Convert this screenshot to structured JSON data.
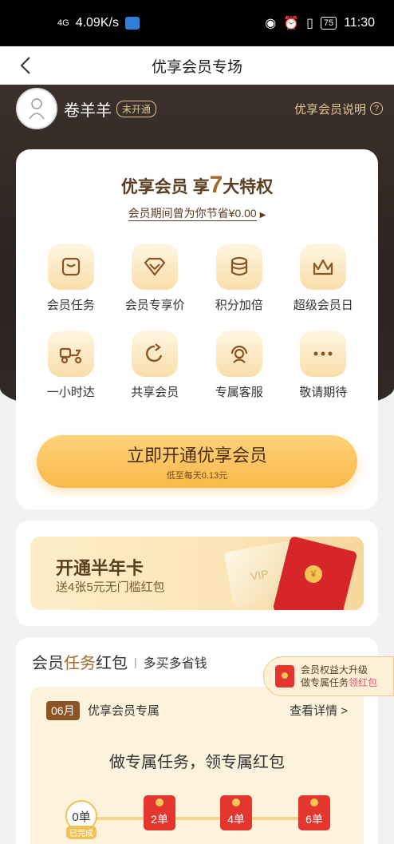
{
  "status_bar": {
    "signal": "4G",
    "speed": "4.09K/s",
    "battery": "75",
    "time": "11:30"
  },
  "nav": {
    "title": "优享会员专场"
  },
  "user": {
    "name": "卷羊羊",
    "membership_status": "未开通",
    "explain_link": "优享会员说明"
  },
  "privileges": {
    "title_prefix": "优享会员 享",
    "title_count": "7",
    "title_suffix": "大特权",
    "saving_text": "会员期间曾为你节省¥0.00",
    "items": [
      {
        "label": "会员任务",
        "icon": "task-icon"
      },
      {
        "label": "会员专享价",
        "icon": "diamond-icon"
      },
      {
        "label": "积分加倍",
        "icon": "coins-icon"
      },
      {
        "label": "超级会员日",
        "icon": "crown-icon"
      },
      {
        "label": "一小时达",
        "icon": "delivery-scooter-icon"
      },
      {
        "label": "共享会员",
        "icon": "share-icon"
      },
      {
        "label": "专属客服",
        "icon": "customer-service-icon"
      },
      {
        "label": "敬请期待",
        "icon": "more-icon"
      }
    ],
    "open_button": {
      "main": "立即开通优享会员",
      "sub": "低至每天0.13元"
    }
  },
  "promo": {
    "title": "开通半年卡",
    "subtitle": "送4张5元无门槛红包",
    "card_text": "VIP",
    "packet_symbol": "¥"
  },
  "task_section": {
    "title_plain": "会员",
    "title_gold": "任务",
    "title_tail": "红包",
    "subtitle": "多买多省钱",
    "bubble": {
      "line1": "会员权益大升级",
      "line2_plain": "做专属任务",
      "line2_pink": "领红包"
    },
    "month_tag": "06月",
    "month_label": "优享会员专属",
    "detail_link": "查看详情 >",
    "slogan": "做专属任务，领专属红包",
    "steps": [
      {
        "label": "0单",
        "tag": "已完成"
      },
      {
        "label": "2单"
      },
      {
        "label": "4单"
      },
      {
        "label": "6单"
      }
    ]
  }
}
